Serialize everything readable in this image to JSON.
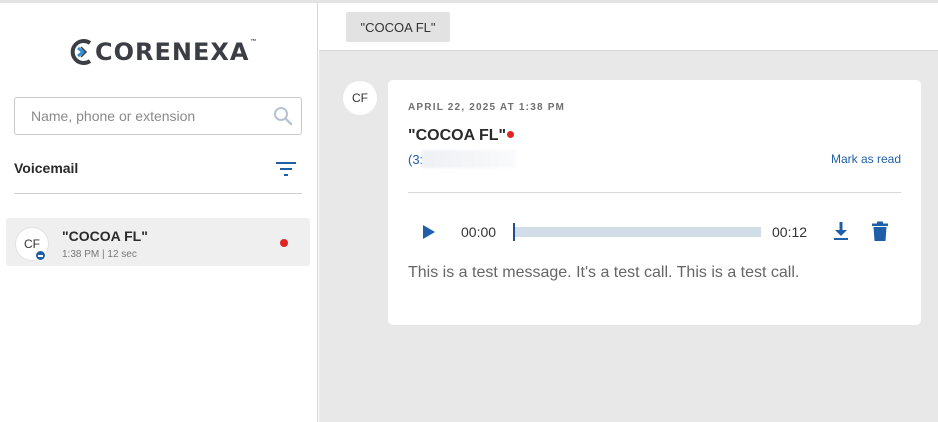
{
  "app": {
    "logo_text": "CORENEXA",
    "logo_tm": "™"
  },
  "sidebar": {
    "search": {
      "value": "",
      "placeholder": "Name, phone or extension"
    },
    "section_title": "Voicemail",
    "items": [
      {
        "initials": "CF",
        "name": "\"COCOA FL\"",
        "meta": "1:38 PM | 12 sec",
        "unread": true
      }
    ]
  },
  "main": {
    "tabs": [
      {
        "label": "\"COCOA FL\""
      }
    ],
    "message": {
      "initials": "CF",
      "date": "APRIL 22, 2025 AT 1:38 PM",
      "caller": "\"COCOA FL\"",
      "phone_visible": "(3:",
      "mark_read_label": "Mark as read",
      "player": {
        "current": "00:00",
        "total": "00:12",
        "progress": 0
      },
      "transcript": "This is a test message. It's a test call. This is a test call."
    }
  },
  "colors": {
    "accent": "#1f5fa8",
    "unread": "#e02424",
    "track": "#d2dde8"
  }
}
